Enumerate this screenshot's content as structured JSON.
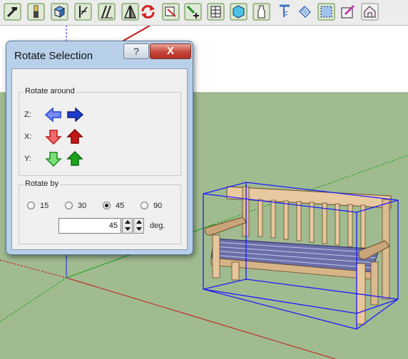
{
  "toolbar": {
    "tools": [
      {
        "icon": "hammer-icon"
      },
      {
        "icon": "paint-brush-icon"
      },
      {
        "icon": "cube-view-icon"
      },
      {
        "icon": "align-left-icon"
      },
      {
        "icon": "align-distribute-icon"
      },
      {
        "icon": "mirror-icon"
      },
      {
        "icon": "rotate-selection-icon"
      },
      {
        "icon": "stretch-icon"
      },
      {
        "icon": "add-component-icon"
      },
      {
        "icon": "grid-panel-icon"
      },
      {
        "icon": "cube-solid-icon"
      },
      {
        "icon": "bottle-icon"
      },
      {
        "icon": "pin-icon"
      },
      {
        "icon": "hatch-icon"
      },
      {
        "icon": "dashed-selection-icon"
      },
      {
        "icon": "pencil-edit-icon"
      },
      {
        "icon": "house-icon"
      }
    ]
  },
  "dialog": {
    "title": "Rotate Selection",
    "help_label": "?",
    "close_label": "X",
    "rotate_around": {
      "label": "Rotate around",
      "axes": [
        {
          "label": "Z:",
          "color": "#1d3fd0"
        },
        {
          "label": "X:",
          "color": "#c01818"
        },
        {
          "label": "Y:",
          "color": "#1aa31a"
        }
      ]
    },
    "rotate_by": {
      "label": "Rotate by",
      "options": [
        "15",
        "30",
        "45",
        "90"
      ],
      "selected": "45",
      "value": "45",
      "unit": "deg."
    }
  },
  "colors": {
    "sky": "#ffffff",
    "ground": "#a1bb90",
    "selection": "#1a1aff",
    "annotation_arrow": "#c01818"
  }
}
